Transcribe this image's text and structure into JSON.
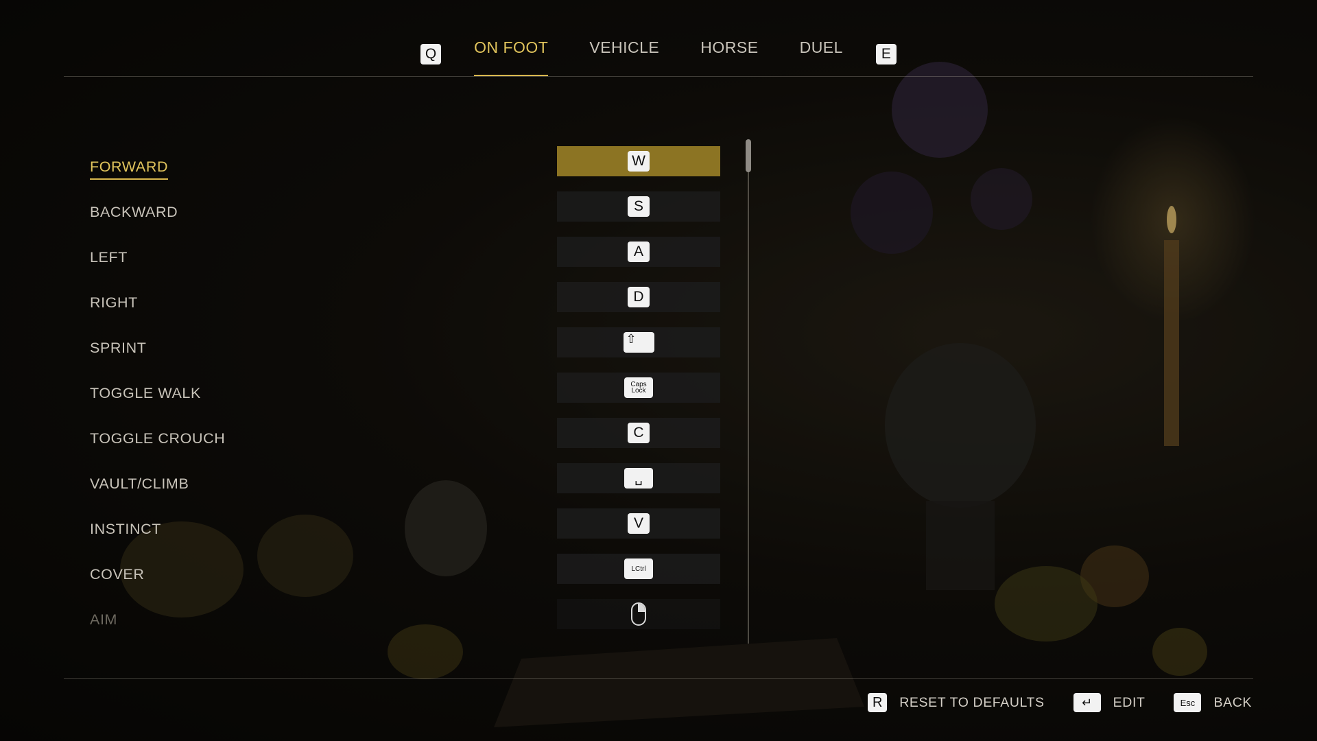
{
  "tabs": {
    "prev_key": "Q",
    "next_key": "E",
    "items": [
      {
        "label": "ON FOOT",
        "active": true
      },
      {
        "label": "VEHICLE",
        "active": false
      },
      {
        "label": "HORSE",
        "active": false
      },
      {
        "label": "DUEL",
        "active": false
      }
    ]
  },
  "actions": [
    {
      "label": "FORWARD",
      "key": "W",
      "key_icon": "key-w"
    },
    {
      "label": "BACKWARD",
      "key": "S",
      "key_icon": "key-s"
    },
    {
      "label": "LEFT",
      "key": "A",
      "key_icon": "key-a"
    },
    {
      "label": "RIGHT",
      "key": "D",
      "key_icon": "key-d"
    },
    {
      "label": "SPRINT",
      "key": "⇧",
      "key_icon": "shift-key-icon"
    },
    {
      "label": "TOGGLE WALK",
      "key": "Caps Lock",
      "key_icon": "caps-lock-key"
    },
    {
      "label": "TOGGLE CROUCH",
      "key": "C",
      "key_icon": "key-c"
    },
    {
      "label": "VAULT/CLIMB",
      "key": "␣",
      "key_icon": "spacebar-key-icon"
    },
    {
      "label": "INSTINCT",
      "key": "V",
      "key_icon": "key-v"
    },
    {
      "label": "COVER",
      "key": "LCtrl",
      "key_icon": "left-ctrl-key"
    },
    {
      "label": "AIM",
      "key": "",
      "key_icon": "mouse-right-button-icon"
    }
  ],
  "footer": {
    "reset": {
      "key": "R",
      "label": "RESET TO DEFAULTS"
    },
    "edit": {
      "key": "↵",
      "label": "EDIT",
      "key_icon": "enter-key-icon"
    },
    "back": {
      "key": "Esc",
      "label": "BACK"
    }
  },
  "colors": {
    "accent": "#e1c45c",
    "selected_bg": "#8c7423"
  }
}
